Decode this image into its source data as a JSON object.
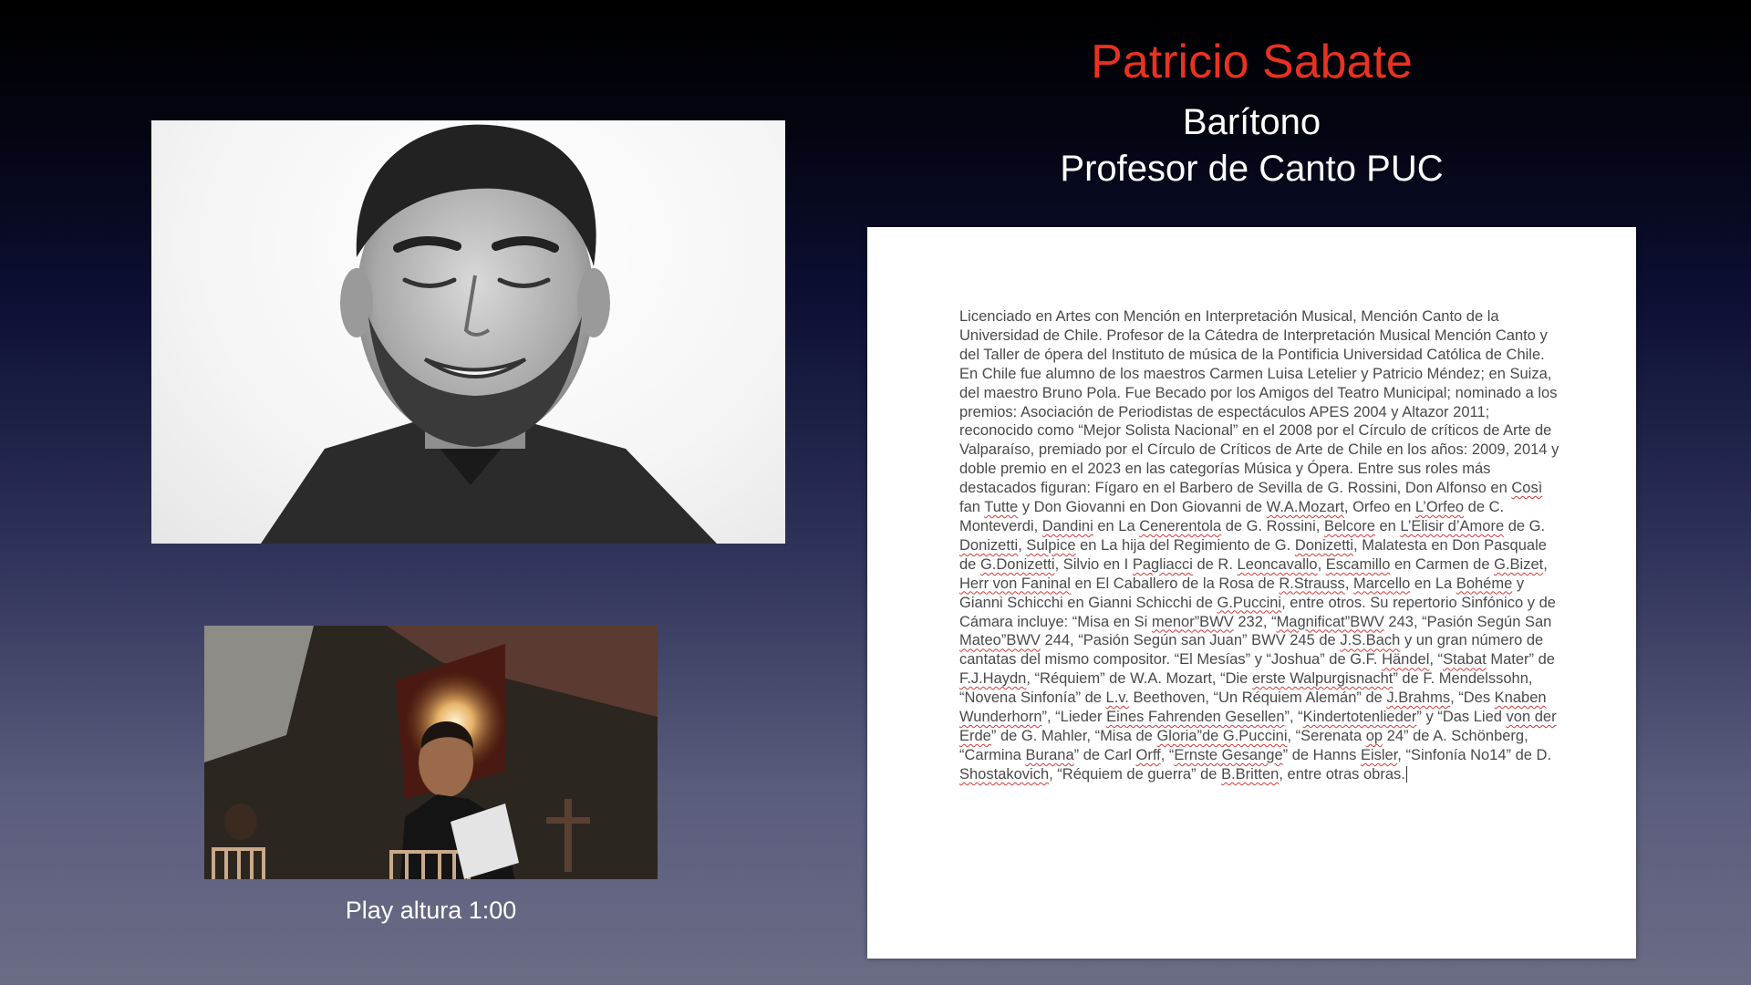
{
  "slide": {
    "title": "Patricio Sabate",
    "subtitle_line1": "Barítono",
    "subtitle_line2": "Profesor de Canto PUC",
    "video_caption": "Play altura 1:00"
  },
  "document": {
    "paragraph": [
      {
        "t": "Licenciado en Artes con Mención en Interpretación Musical, Mención Canto de la Universidad de Chile. Profesor de la Cátedra de Interpretación Musical Mención Canto y del Taller de ópera del Instituto de música de la Pontificia Universidad Católica de Chile. En Chile fue alumno de los maestros Carmen Luisa Letelier y Patricio Méndez; en Suiza, del maestro Bruno Pola. Fue Becado por los Amigos del Teatro Municipal; nominado a los premios: Asociación de Periodistas de espectáculos APES 2004 y Altazor 2011; reconocido como “Mejor Solista Nacional” en el 2008 por el Círculo de críticos de Arte de Valparaíso, premiado por el Círculo de Críticos de Arte de Chile en los años: 2009, 2014 y doble premio en el 2023 en las categorías Música y Ópera. Entre sus roles más destacados figuran: Fígaro en el Barbero de Sevilla de G. Rossini, Don Alfonso en ",
        "s": false
      },
      {
        "t": "Così",
        "s": true
      },
      {
        "t": " fan ",
        "s": false
      },
      {
        "t": "Tutte",
        "s": true
      },
      {
        "t": " y Don Giovanni en Don Giovanni de ",
        "s": false
      },
      {
        "t": "W.A.Mozart",
        "s": true
      },
      {
        "t": ", Orfeo en ",
        "s": false
      },
      {
        "t": "L’Orfeo",
        "s": true
      },
      {
        "t": " de C. Monteverdi, ",
        "s": false
      },
      {
        "t": "Dandini",
        "s": true
      },
      {
        "t": " en La ",
        "s": false
      },
      {
        "t": "Cenerentola",
        "s": true
      },
      {
        "t": " de G. Rossini, ",
        "s": false
      },
      {
        "t": "Belcore",
        "s": true
      },
      {
        "t": " en ",
        "s": false
      },
      {
        "t": "L’Elisir d’Amore",
        "s": true
      },
      {
        "t": " de G. ",
        "s": false
      },
      {
        "t": "Donizetti",
        "s": true
      },
      {
        "t": ", ",
        "s": false
      },
      {
        "t": "Sulpice",
        "s": true
      },
      {
        "t": " en La hija del Regimiento de G. ",
        "s": false
      },
      {
        "t": "Donizetti",
        "s": true
      },
      {
        "t": ", Malatesta en Don Pasquale de ",
        "s": false
      },
      {
        "t": "G.Donizetti",
        "s": true
      },
      {
        "t": ", Silvio en I ",
        "s": false
      },
      {
        "t": "Pagliacci",
        "s": true
      },
      {
        "t": " de R. ",
        "s": false
      },
      {
        "t": "Leoncavallo",
        "s": true
      },
      {
        "t": ", ",
        "s": false
      },
      {
        "t": "Escamillo",
        "s": true
      },
      {
        "t": " en Carmen de ",
        "s": false
      },
      {
        "t": "G.Bizet",
        "s": true
      },
      {
        "t": ", ",
        "s": false
      },
      {
        "t": "Herr von Faninal",
        "s": true
      },
      {
        "t": " en El Caballero de la Rosa de ",
        "s": false
      },
      {
        "t": "R.Strauss",
        "s": true
      },
      {
        "t": ", ",
        "s": false
      },
      {
        "t": "Marcello",
        "s": true
      },
      {
        "t": " en La ",
        "s": false
      },
      {
        "t": "Bohéme",
        "s": true
      },
      {
        "t": " y Gianni Schicchi en Gianni Schicchi de ",
        "s": false
      },
      {
        "t": "G.Puccini",
        "s": true
      },
      {
        "t": ", entre otros. Su repertorio Sinfónico y de Cámara incluye: “Misa en Si ",
        "s": false
      },
      {
        "t": "menor”BWV",
        "s": true
      },
      {
        "t": " 232, “",
        "s": false
      },
      {
        "t": "Magnificat”BWV",
        "s": true
      },
      {
        "t": " 243, “Pasión Según San ",
        "s": false
      },
      {
        "t": "Mateo”BWV",
        "s": true
      },
      {
        "t": " 244, “Pasión Según san Juan” BWV 245 de ",
        "s": false
      },
      {
        "t": "J.S.Bach",
        "s": true
      },
      {
        "t": " y un gran número de cantatas del mismo compositor. “El Mesías” y “Joshua” de G.F. ",
        "s": false
      },
      {
        "t": "Händel",
        "s": true
      },
      {
        "t": ", “",
        "s": false
      },
      {
        "t": "Stabat",
        "s": true
      },
      {
        "t": " Mater” de ",
        "s": false
      },
      {
        "t": "F.J.Haydn",
        "s": true
      },
      {
        "t": ", “Réquiem” de W.A. Mozart, “Die ",
        "s": false
      },
      {
        "t": "erste Walpurgisnacht",
        "s": true
      },
      {
        "t": "” de F. Mendelssohn, “Novena Sinfonía” de ",
        "s": false
      },
      {
        "t": "L.v.",
        "s": true
      },
      {
        "t": " Beethoven, “Un Réquiem Alemán” de ",
        "s": false
      },
      {
        "t": "J.Brahms",
        "s": true
      },
      {
        "t": ", “Des ",
        "s": false
      },
      {
        "t": "Knaben Wunderhorn",
        "s": true
      },
      {
        "t": "”, “Lieder ",
        "s": false
      },
      {
        "t": "Eines Fahrenden Gesellen",
        "s": true
      },
      {
        "t": "”, “",
        "s": false
      },
      {
        "t": "Kindertotenlieder",
        "s": true
      },
      {
        "t": "” y “Das Lied ",
        "s": false
      },
      {
        "t": "von der Erde",
        "s": true
      },
      {
        "t": "” de G. Mahler, “Misa de ",
        "s": false
      },
      {
        "t": "Gloria”de G.Puccini",
        "s": true
      },
      {
        "t": ", “Serenata ",
        "s": false
      },
      {
        "t": "op",
        "s": true
      },
      {
        "t": " 24” de A. Schönberg, “Carmina ",
        "s": false
      },
      {
        "t": "Burana",
        "s": true
      },
      {
        "t": "” de Carl ",
        "s": false
      },
      {
        "t": "Orff",
        "s": true
      },
      {
        "t": ", “",
        "s": false
      },
      {
        "t": "Ernste Gesange",
        "s": true
      },
      {
        "t": "” de Hanns ",
        "s": false
      },
      {
        "t": "Eisler",
        "s": true
      },
      {
        "t": ", “Sinfonía No14” de D. ",
        "s": false
      },
      {
        "t": "Shostakovich",
        "s": true
      },
      {
        "t": ", “Réquiem de guerra” de ",
        "s": false
      },
      {
        "t": "B.Britten",
        "s": true
      },
      {
        "t": ", entre otras obras.",
        "s": false
      }
    ]
  },
  "colors": {
    "title": "#e8321f",
    "subtitle": "#ffffff",
    "spellcheck_underline": "#d23a3a"
  }
}
